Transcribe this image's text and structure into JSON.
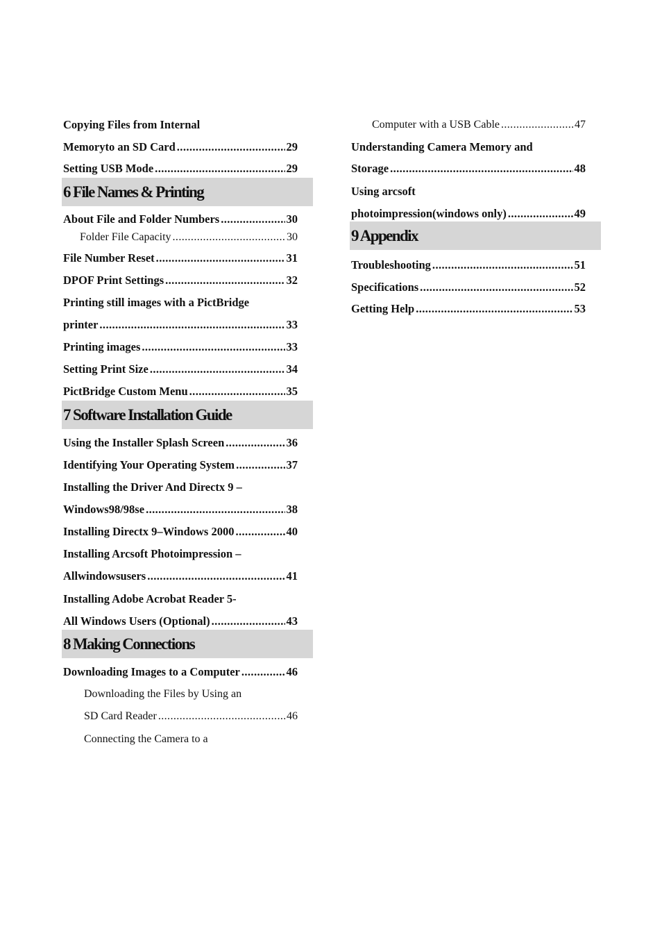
{
  "left_column": [
    {
      "type": "entry",
      "style": "bold",
      "text": "Copying Files from Internal",
      "page": ""
    },
    {
      "type": "entry",
      "style": "bold",
      "text": "Memoryto an SD Card",
      "page": "29"
    },
    {
      "type": "entry",
      "style": "bold",
      "text": "Setting USB Mode",
      "page": "29"
    },
    {
      "type": "header",
      "text": "6 File Names & Printing"
    },
    {
      "type": "entry",
      "style": "bold",
      "text": "About File and Folder Numbers",
      "page": "30"
    },
    {
      "type": "entry",
      "style": "sub",
      "text": "Folder File Capacity",
      "page": "30"
    },
    {
      "type": "entry",
      "style": "bold",
      "text": "File Number Reset",
      "page": "31"
    },
    {
      "type": "entry",
      "style": "bold",
      "text": "DPOF Print Settings",
      "page": "32"
    },
    {
      "type": "entry",
      "style": "bold",
      "text": "Printing still images with a PictBridge",
      "page": ""
    },
    {
      "type": "entry",
      "style": "bold",
      "text": "printer",
      "page": "33"
    },
    {
      "type": "entry",
      "style": "bold",
      "text": "Printing images",
      "page": "33"
    },
    {
      "type": "entry",
      "style": "bold",
      "text": "Setting Print Size",
      "page": "34"
    },
    {
      "type": "entry",
      "style": "bold",
      "text": "PictBridge Custom Menu",
      "page": "35"
    },
    {
      "type": "header",
      "text": "7 Software Installation Guide"
    },
    {
      "type": "entry",
      "style": "bold",
      "text": "Using the Installer Splash Screen",
      "page": "36"
    },
    {
      "type": "entry",
      "style": "bold",
      "text": "Identifying Your Operating System",
      "page": "37"
    },
    {
      "type": "entry",
      "style": "bold",
      "text": "Installing the Driver And Directx 9 –",
      "page": ""
    },
    {
      "type": "entry",
      "style": "bold",
      "text": "Windows98/98se",
      "page": "38"
    },
    {
      "type": "entry",
      "style": "bold",
      "text": "Installing Directx 9–Windows 2000",
      "page": "40"
    },
    {
      "type": "entry",
      "style": "bold",
      "text": "Installing Arcsoft Photoimpression –",
      "page": ""
    },
    {
      "type": "entry",
      "style": "bold",
      "text": "Allwindowsusers",
      "page": "41"
    },
    {
      "type": "entry",
      "style": "bold",
      "text": "Installing Adobe Acrobat Reader 5-",
      "page": ""
    },
    {
      "type": "entry",
      "style": "bold",
      "text": "All Windows Users (Optional)",
      "page": "43"
    },
    {
      "type": "header",
      "text": "8 Making Connections"
    },
    {
      "type": "entry",
      "style": "bold",
      "text": "Downloading Images to a Computer",
      "page": "46"
    },
    {
      "type": "entry",
      "style": "sub",
      "text": "Downloading the Files by Using an",
      "page": ""
    },
    {
      "type": "entry",
      "style": "sub",
      "text": "SD Card Reader",
      "page": "46"
    },
    {
      "type": "entry",
      "style": "sub",
      "text": "Connecting the Camera to a",
      "page": ""
    }
  ],
  "right_column": [
    {
      "type": "entry",
      "style": "sub",
      "text": "Computer with a USB Cable",
      "page": "47"
    },
    {
      "type": "entry",
      "style": "bold",
      "text": "Understanding Camera Memory and",
      "page": ""
    },
    {
      "type": "entry",
      "style": "bold",
      "text": "Storage",
      "page": "48"
    },
    {
      "type": "entry",
      "style": "bold",
      "text": "Using arcsoft",
      "page": ""
    },
    {
      "type": "entry",
      "style": "bold",
      "text": "photoimpression(windows only)",
      "page": "49"
    },
    {
      "type": "header",
      "text": "9 Appendix"
    },
    {
      "type": "entry",
      "style": "bold",
      "text": "Troubleshooting",
      "page": "51"
    },
    {
      "type": "entry",
      "style": "bold",
      "text": "Specifications",
      "page": "52"
    },
    {
      "type": "entry",
      "style": "bold",
      "text": "Getting Help",
      "page": "53"
    }
  ]
}
